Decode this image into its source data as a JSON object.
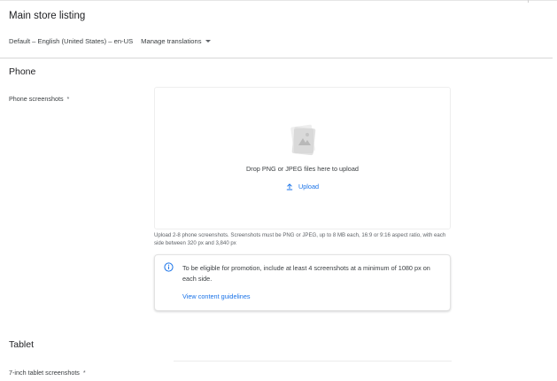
{
  "store_listing": {
    "title": "Main store listing",
    "language": "Default – English (United States) – en-US",
    "manage_translations": "Manage translations"
  },
  "phone": {
    "section_title": "Phone",
    "field_label": "Phone screenshots",
    "required_mark": "*",
    "dropzone": {
      "text": "Drop PNG or JPEG files here to upload",
      "upload_label": "Upload"
    },
    "help_text": "Upload 2-8 phone screenshots. Screenshots must be PNG or JPEG, up to 8 MB each, 16:9 or 9:16 aspect ratio, with each side between 320 px and 3,840 px",
    "info": {
      "text": "To be eligible for promotion, include at least 4 screenshots at a minimum of 1080 px on each side.",
      "link": "View content guidelines"
    }
  },
  "tablet": {
    "section_title": "Tablet",
    "field_label": "7-inch tablet screenshots",
    "required_mark": "*"
  },
  "colors": {
    "link": "#1a73e8",
    "text_primary": "#202124",
    "text_secondary": "#5f6368"
  }
}
